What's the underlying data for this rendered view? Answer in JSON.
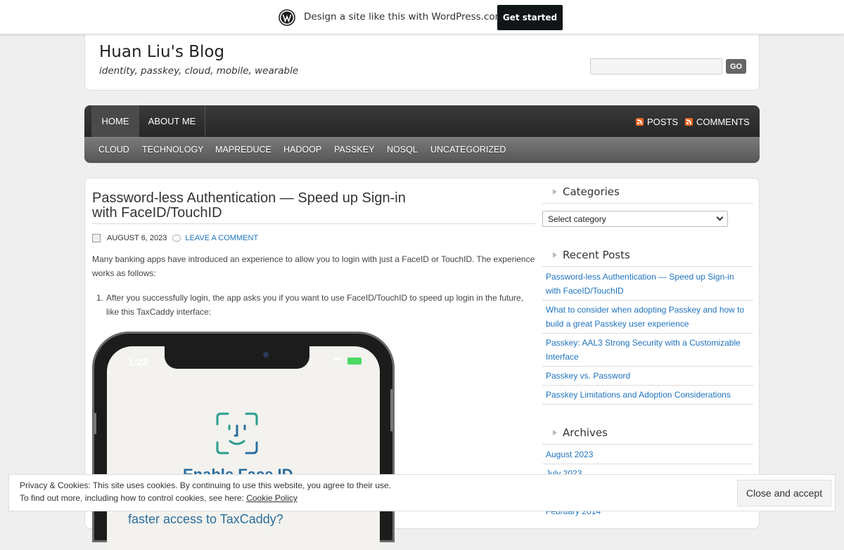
{
  "wpbar": {
    "text": "Design a site like this with WordPress.com",
    "button": "Get started",
    "logo_icon": "wordpress-logo-icon"
  },
  "header": {
    "title": "Huan Liu's Blog",
    "description": "identity, passkey, cloud, mobile, wearable",
    "search_value": "",
    "search_button": "GO"
  },
  "nav": {
    "pages": [
      "HOME",
      "ABOUT ME"
    ],
    "feeds": [
      "POSTS",
      "COMMENTS"
    ],
    "categories": [
      "CLOUD",
      "TECHNOLOGY",
      "MAPREDUCE",
      "HADOOP",
      "PASSKEY",
      "NOSQL",
      "UNCATEGORIZED"
    ]
  },
  "post": {
    "title": "Password-less Authentication — Speed up Sign-in with FaceID/TouchID",
    "date": "AUGUST 6, 2023",
    "comment_link": "LEAVE A COMMENT",
    "intro": "Many banking apps have introduced an experience to allow you to login with just a FaceID or TouchID. The experience works as follows:",
    "list_number": "1.",
    "list_item": "After you successfully login, the app asks you if you want to use FaceID/TouchID to speed up login in the future, like this TaxCaddy interface:",
    "phone": {
      "time": "1:22",
      "enable_text": "Enable Face ID",
      "faster_text": "faster access to TaxCaddy?"
    }
  },
  "sidebar": {
    "categories_title": "Categories",
    "categories_select": "Select category",
    "recent_title": "Recent Posts",
    "recent_posts": [
      "Password-less Authentication — Speed up Sign-in with FaceID/TouchID",
      "What to consider when adopting Passkey and how to build a great Passkey user experience",
      "Passkey: AAL3 Strong Security with a Customizable Interface",
      "Passkey vs. Password",
      "Passkey Limitations and Adoption Considerations"
    ],
    "archives_title": "Archives",
    "archives": [
      "August 2023",
      "July 2023",
      "February 2014"
    ]
  },
  "cookie": {
    "line1": "Privacy & Cookies: This site uses cookies. By continuing to use this website, you agree to their use.",
    "line2": "To find out more, including how to control cookies, see here: ",
    "link": "Cookie Policy",
    "button": "Close and accept"
  },
  "colors": {
    "link": "#1e73be",
    "nav_dark": "#2f2f2f",
    "rss": "#f26522"
  }
}
